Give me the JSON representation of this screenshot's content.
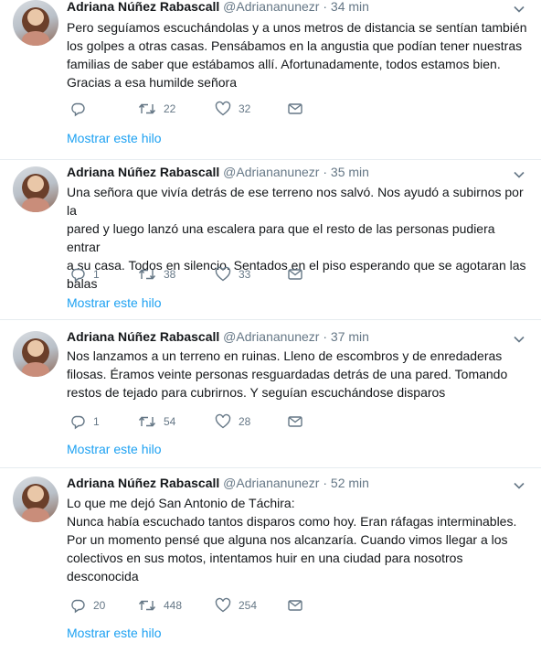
{
  "tweets": [
    {
      "name": "Adriana Núñez Rabascall",
      "handle": "@Adriananunezr",
      "dot": "·",
      "time": "34 min",
      "lines": [
        "Pero seguíamos escuchándolas y a unos metros de distancia se sentían también",
        "los golpes a otras casas. Pensábamos en la angustia que podían tener nuestras",
        "familias de saber que estábamos allí. Afortunadamente, todos estamos bien.",
        "Gracias a esa humilde señora"
      ],
      "reply_count": "",
      "retweet_count": "22",
      "like_count": "32",
      "show_thread": "Mostrar este hilo"
    },
    {
      "name": "Adriana Núñez Rabascall",
      "handle": "@Adriananunezr",
      "dot": "·",
      "time": "35 min",
      "lines": [
        "Una señora que vivía detrás de ese terreno nos salvó. Nos ayudó a subirnos por la",
        "pared y luego lanzó una escalera para que el resto de las personas pudiera entrar",
        "a su casa. Todos en silencio. Sentados en el piso esperando que se agotaran las",
        "balas"
      ],
      "reply_count": "1",
      "retweet_count": "38",
      "like_count": "33",
      "show_thread": "Mostrar este hilo"
    },
    {
      "name": "Adriana Núñez Rabascall",
      "handle": "@Adriananunezr",
      "dot": "·",
      "time": "37 min",
      "lines": [
        "Nos lanzamos a un terreno en ruinas. Lleno de escombros y de enredaderas",
        "filosas.  Éramos veinte personas resguardadas detrás de una pared. Tomando",
        "restos de tejado para cubrirnos. Y seguían escuchándose disparos"
      ],
      "reply_count": "1",
      "retweet_count": "54",
      "like_count": "28",
      "show_thread": "Mostrar este hilo"
    },
    {
      "name": "Adriana Núñez Rabascall",
      "handle": "@Adriananunezr",
      "dot": "·",
      "time": "52 min",
      "lines": [
        "Lo que me dejó San Antonio de Táchira:",
        "Nunca había escuchado tantos disparos como hoy. Eran ráfagas interminables.",
        "Por un momento pensé que alguna nos alcanzaría. Cuando vimos llegar a los",
        "colectivos en sus motos, intentamos huir en una ciudad para nosotros",
        "desconocida"
      ],
      "reply_count": "20",
      "retweet_count": "448",
      "like_count": "254",
      "show_thread": "Mostrar este hilo"
    }
  ],
  "colors": {
    "text": "#14171a",
    "secondary": "#657786",
    "link": "#1da1f2",
    "divider": "#e6ecf0"
  },
  "icons": [
    "reply-icon",
    "retweet-icon",
    "like-icon",
    "message-icon",
    "chevron-down-icon"
  ]
}
